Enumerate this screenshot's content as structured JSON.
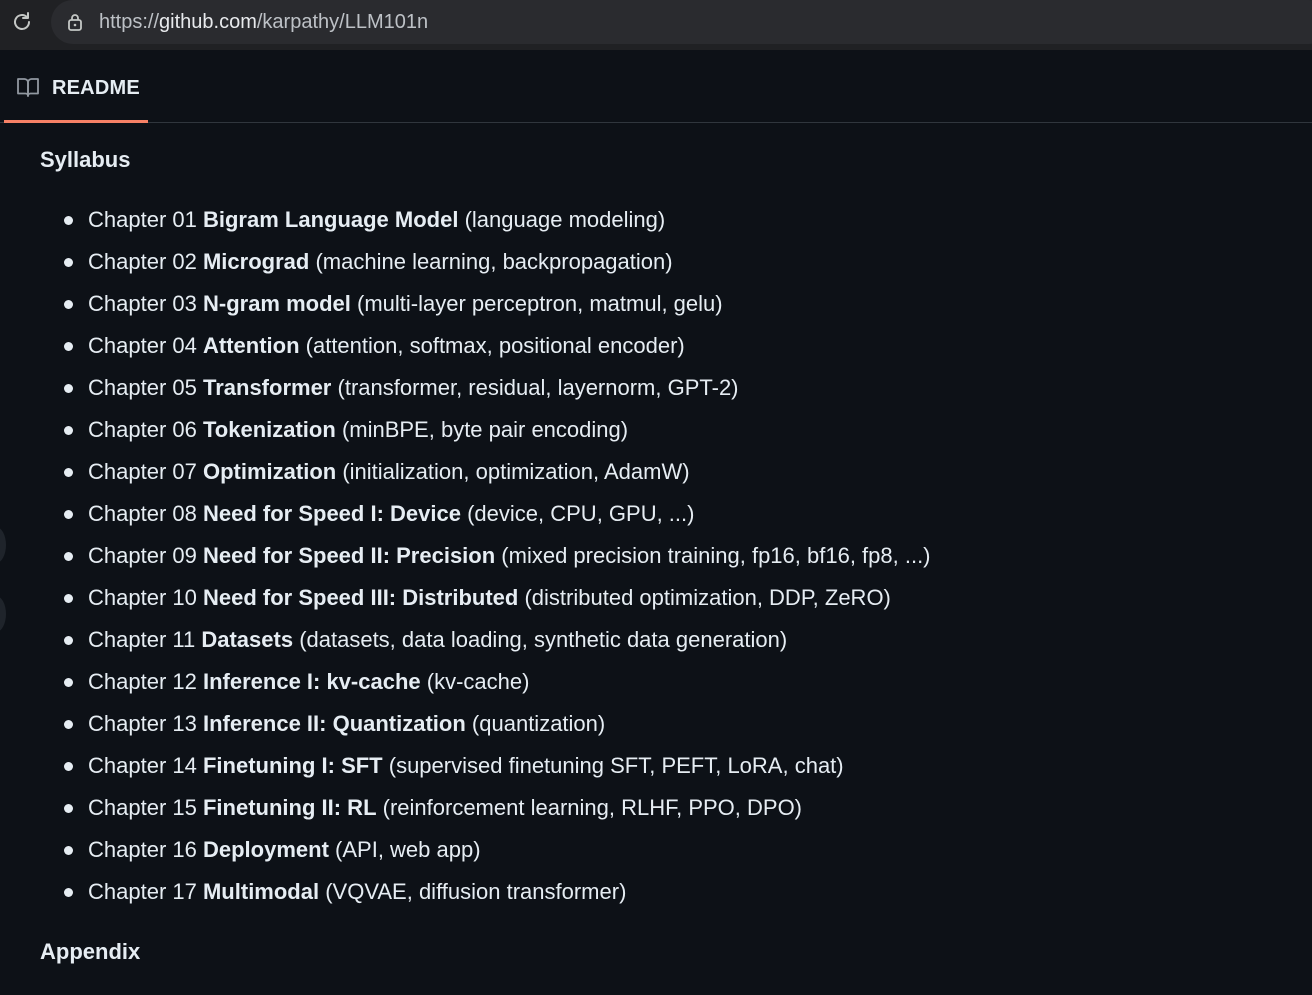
{
  "browser": {
    "url_prefix": "https://",
    "url_host": "github.com",
    "url_path": "/karpathy/LLM101n"
  },
  "readme": {
    "tab_label": "README"
  },
  "content": {
    "syllabus_heading": "Syllabus",
    "appendix_heading": "Appendix",
    "chapters": [
      {
        "num": "Chapter 01",
        "title": "Bigram Language Model",
        "topics": "(language modeling)"
      },
      {
        "num": "Chapter 02",
        "title": "Micrograd",
        "topics": "(machine learning, backpropagation)"
      },
      {
        "num": "Chapter 03",
        "title": "N-gram model",
        "topics": "(multi-layer perceptron, matmul, gelu)"
      },
      {
        "num": "Chapter 04",
        "title": "Attention",
        "topics": "(attention, softmax, positional encoder)"
      },
      {
        "num": "Chapter 05",
        "title": "Transformer",
        "topics": "(transformer, residual, layernorm, GPT-2)"
      },
      {
        "num": "Chapter 06",
        "title": "Tokenization",
        "topics": "(minBPE, byte pair encoding)"
      },
      {
        "num": "Chapter 07",
        "title": "Optimization",
        "topics": "(initialization, optimization, AdamW)"
      },
      {
        "num": "Chapter 08",
        "title": "Need for Speed I: Device",
        "topics": "(device, CPU, GPU, ...)"
      },
      {
        "num": "Chapter 09",
        "title": "Need for Speed II: Precision",
        "topics": "(mixed precision training, fp16, bf16, fp8, ...)"
      },
      {
        "num": "Chapter 10",
        "title": "Need for Speed III: Distributed",
        "topics": "(distributed optimization, DDP, ZeRO)"
      },
      {
        "num": "Chapter 11",
        "title": "Datasets",
        "topics": "(datasets, data loading, synthetic data generation)"
      },
      {
        "num": "Chapter 12",
        "title": "Inference I: kv-cache",
        "topics": "(kv-cache)"
      },
      {
        "num": "Chapter 13",
        "title": "Inference II: Quantization",
        "topics": "(quantization)"
      },
      {
        "num": "Chapter 14",
        "title": "Finetuning I: SFT",
        "topics": "(supervised finetuning SFT, PEFT, LoRA, chat)"
      },
      {
        "num": "Chapter 15",
        "title": "Finetuning II: RL",
        "topics": "(reinforcement learning, RLHF, PPO, DPO)"
      },
      {
        "num": "Chapter 16",
        "title": "Deployment",
        "topics": "(API, web app)"
      },
      {
        "num": "Chapter 17",
        "title": "Multimodal",
        "topics": "(VQVAE, diffusion transformer)"
      }
    ]
  },
  "colors": {
    "background": "#0d1117",
    "text": "#e6edf3",
    "tab_underline": "#f78166",
    "browser_bar": "#202124",
    "url_box": "#2a2b2f"
  },
  "icons": {
    "reload": "reload-icon",
    "lock": "lock-icon",
    "readme": "book-icon"
  }
}
